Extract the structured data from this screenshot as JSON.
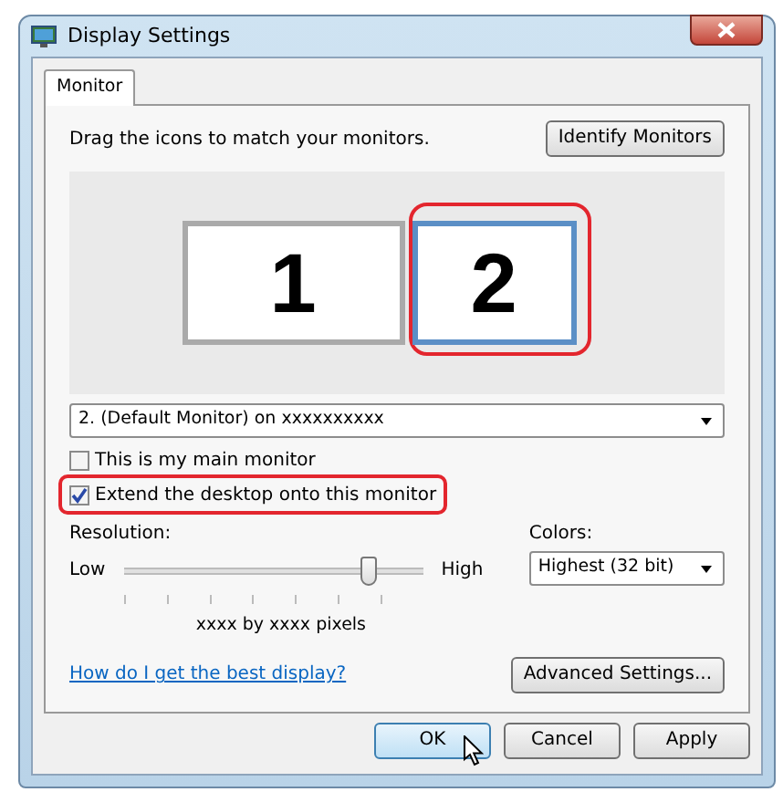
{
  "window": {
    "title": "Display Settings"
  },
  "tabs": [
    {
      "label": "Monitor",
      "selected": true
    }
  ],
  "instruction": "Drag the icons to match your monitors.",
  "identify_button": "Identify Monitors",
  "monitors": [
    {
      "number": "1",
      "selected": false,
      "highlighted": false
    },
    {
      "number": "2",
      "selected": true,
      "highlighted": true
    }
  ],
  "display_select": {
    "value": "2. (Default Monitor) on xxxxxxxxxx"
  },
  "checkboxes": [
    {
      "label": "This is my main monitor",
      "checked": false,
      "highlighted": false
    },
    {
      "label": "Extend the desktop onto this monitor",
      "checked": true,
      "highlighted": true
    }
  ],
  "resolution": {
    "label": "Resolution:",
    "low": "Low",
    "high": "High",
    "level": 0.82,
    "reading": "xxxx by xxxx pixels"
  },
  "colors": {
    "label": "Colors:",
    "value": "Highest (32 bit)"
  },
  "help_link": "How do I get the best display?",
  "advanced_button": "Advanced Settings...",
  "buttons": [
    {
      "label": "OK",
      "default": true
    },
    {
      "label": "Cancel",
      "default": false
    },
    {
      "label": "Apply",
      "default": false
    }
  ]
}
